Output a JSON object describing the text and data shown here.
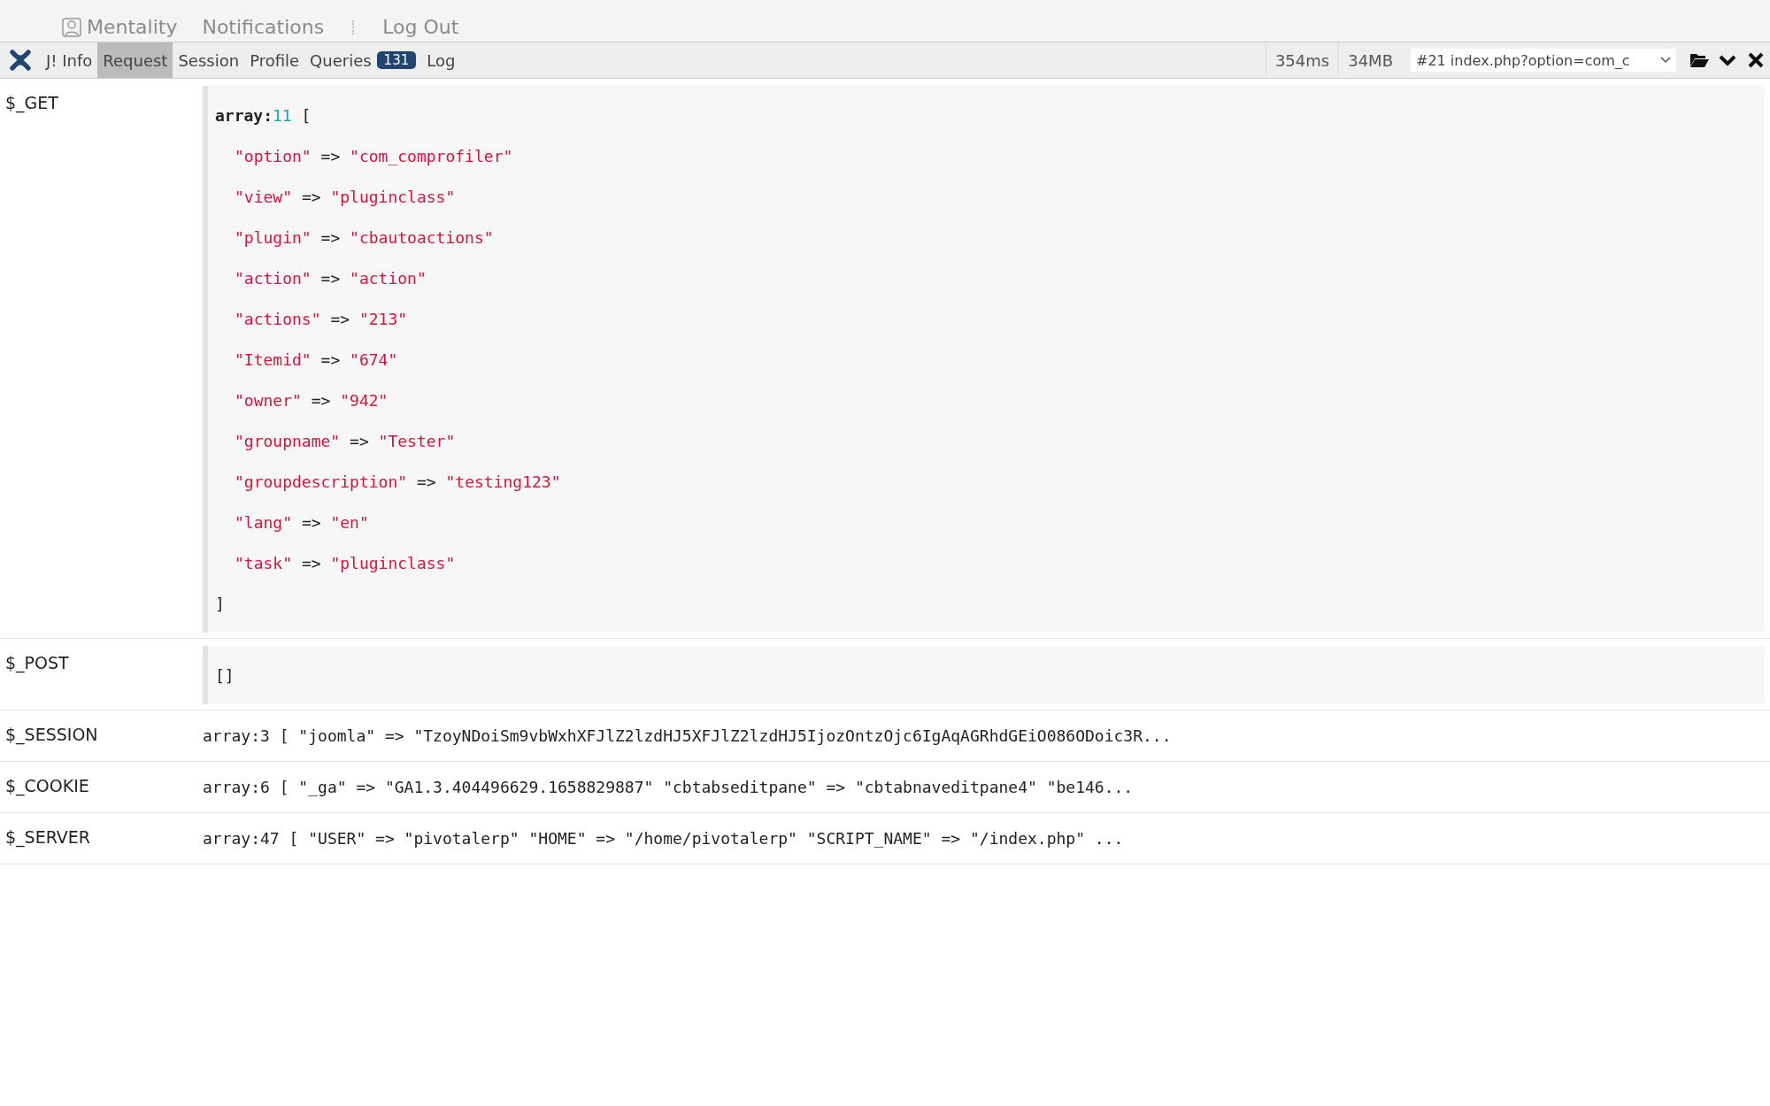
{
  "top_nav": [
    {
      "label": "Mentality",
      "kind": "user"
    },
    {
      "label": "Notifications",
      "kind": "link"
    },
    {
      "label": "Log Out",
      "kind": "link"
    }
  ],
  "toolbar": {
    "tabs": [
      {
        "label": "J! Info",
        "selected": false
      },
      {
        "label": "Request",
        "selected": true
      },
      {
        "label": "Session",
        "selected": false
      },
      {
        "label": "Profile",
        "selected": false
      },
      {
        "label": "Queries",
        "selected": false,
        "badge": "131"
      },
      {
        "label": "Log",
        "selected": false
      }
    ],
    "stats": [
      "354ms",
      "34MB"
    ],
    "request_select": {
      "value": "#21 index.php?option=com_c"
    }
  },
  "sections": [
    {
      "label": "$_GET",
      "kind": "expanded",
      "type_prefix": "array:",
      "arrow": "=>",
      "count": "11",
      "open": "[",
      "close": "]",
      "entries": [
        {
          "key": "\"option\"",
          "value": "\"com_comprofiler\""
        },
        {
          "key": "\"view\"",
          "value": "\"pluginclass\""
        },
        {
          "key": "\"plugin\"",
          "value": "\"cbautoactions\""
        },
        {
          "key": "\"action\"",
          "value": "\"action\""
        },
        {
          "key": "\"actions\"",
          "value": "\"213\""
        },
        {
          "key": "\"Itemid\"",
          "value": "\"674\""
        },
        {
          "key": "\"owner\"",
          "value": "\"942\""
        },
        {
          "key": "\"groupname\"",
          "value": "\"Tester\""
        },
        {
          "key": "\"groupdescription\"",
          "value": "\"testing123\""
        },
        {
          "key": "\"lang\"",
          "value": "\"en\""
        },
        {
          "key": "\"task\"",
          "value": "\"pluginclass\""
        }
      ]
    },
    {
      "label": "$_POST",
      "kind": "empty",
      "text": "[]"
    },
    {
      "label": "$_SESSION",
      "kind": "summary",
      "text": "array:3 [ \"joomla\" => \"TzoyNDoiSm9vbWxhXFJlZ2lzdHJ5XFJlZ2lzdHJ5IjozOntzOjc6IgAqAGRhdGEiO086ODoic3R..."
    },
    {
      "label": "$_COOKIE",
      "kind": "summary",
      "text": "array:6 [ \"_ga\" => \"GA1.3.404496629.1658829887\" \"cbtabseditpane\" => \"cbtabnaveditpane4\" \"be146..."
    },
    {
      "label": "$_SERVER",
      "kind": "summary",
      "text": "array:47 [ \"USER\" => \"pivotalerp\" \"HOME\" => \"/home/pivotalerp\" \"SCRIPT_NAME\" => \"/index.php\" ..."
    }
  ]
}
